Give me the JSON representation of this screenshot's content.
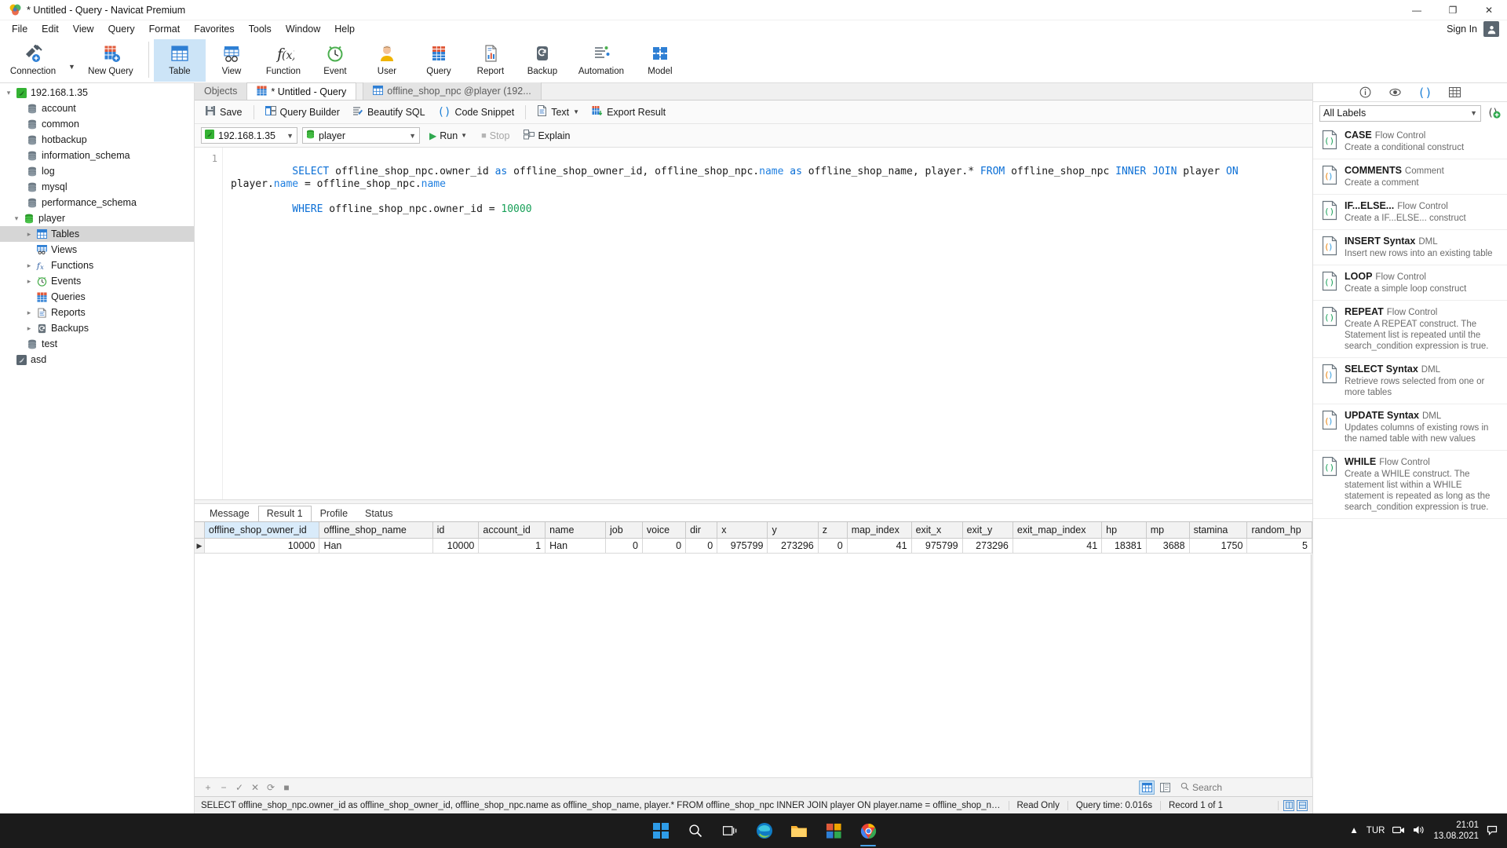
{
  "window": {
    "title": "* Untitled - Query - Navicat Premium",
    "minimize": "—",
    "maximize": "❐",
    "close": "✕"
  },
  "menu": {
    "items": [
      "File",
      "Edit",
      "View",
      "Query",
      "Format",
      "Favorites",
      "Tools",
      "Window",
      "Help"
    ],
    "sign_in": "Sign In"
  },
  "ribbon": {
    "items": [
      {
        "label": "Connection",
        "icon": "connection-icon"
      },
      {
        "label": "New Query",
        "icon": "new-query-icon"
      },
      {
        "label": "Table",
        "icon": "table-icon",
        "selected": true
      },
      {
        "label": "View",
        "icon": "view-icon"
      },
      {
        "label": "Function",
        "icon": "function-icon"
      },
      {
        "label": "Event",
        "icon": "event-icon"
      },
      {
        "label": "User",
        "icon": "user-icon"
      },
      {
        "label": "Query",
        "icon": "query-icon"
      },
      {
        "label": "Report",
        "icon": "report-icon"
      },
      {
        "label": "Backup",
        "icon": "backup-icon"
      },
      {
        "label": "Automation",
        "icon": "automation-icon"
      },
      {
        "label": "Model",
        "icon": "model-icon"
      }
    ]
  },
  "tree": [
    {
      "label": "192.168.1.35",
      "depth": 0,
      "arrow": "down",
      "icon": "connection-host-icon"
    },
    {
      "label": "account",
      "depth": 1,
      "arrow": "",
      "icon": "database-icon"
    },
    {
      "label": "common",
      "depth": 1,
      "arrow": "",
      "icon": "database-icon"
    },
    {
      "label": "hotbackup",
      "depth": 1,
      "arrow": "",
      "icon": "database-icon"
    },
    {
      "label": "information_schema",
      "depth": 1,
      "arrow": "",
      "icon": "database-icon"
    },
    {
      "label": "log",
      "depth": 1,
      "arrow": "",
      "icon": "database-icon"
    },
    {
      "label": "mysql",
      "depth": 1,
      "arrow": "",
      "icon": "database-icon"
    },
    {
      "label": "performance_schema",
      "depth": 1,
      "arrow": "",
      "icon": "database-icon"
    },
    {
      "label": "player",
      "depth": 1,
      "arrow": "down",
      "icon": "database-open-icon"
    },
    {
      "label": "Tables",
      "depth": 2,
      "arrow": "right",
      "icon": "tables-icon",
      "selected": true
    },
    {
      "label": "Views",
      "depth": 2,
      "arrow": "",
      "icon": "views-icon"
    },
    {
      "label": "Functions",
      "depth": 2,
      "arrow": "right",
      "icon": "functions-icon"
    },
    {
      "label": "Events",
      "depth": 2,
      "arrow": "right",
      "icon": "events-icon"
    },
    {
      "label": "Queries",
      "depth": 2,
      "arrow": "",
      "icon": "queries-icon"
    },
    {
      "label": "Reports",
      "depth": 2,
      "arrow": "right",
      "icon": "reports-icon"
    },
    {
      "label": "Backups",
      "depth": 2,
      "arrow": "right",
      "icon": "backups-icon"
    },
    {
      "label": "test",
      "depth": 1,
      "arrow": "",
      "icon": "database-icon"
    },
    {
      "label": "asd",
      "depth": 0,
      "arrow": "",
      "icon": "connection-host-icon"
    }
  ],
  "tabs": {
    "objects": "Objects",
    "query": "* Untitled - Query",
    "table": "offline_shop_npc @player (192..."
  },
  "query_toolbar": {
    "save": "Save",
    "query_builder": "Query Builder",
    "beautify_sql": "Beautify SQL",
    "code_snippet": "Code Snippet",
    "text": "Text",
    "export_result": "Export Result"
  },
  "connection_bar": {
    "host": "192.168.1.35",
    "database": "player",
    "run": "Run",
    "stop": "Stop",
    "explain": "Explain"
  },
  "editor": {
    "line_number": "1",
    "sql_line1_parts": [
      {
        "t": "SELECT ",
        "c": "kw"
      },
      {
        "t": "offline_shop_npc.owner_id ",
        "c": ""
      },
      {
        "t": "as ",
        "c": "kw"
      },
      {
        "t": "offline_shop_owner_id, offline_shop_npc.",
        "c": ""
      },
      {
        "t": "name ",
        "c": "fn"
      },
      {
        "t": "as ",
        "c": "kw"
      },
      {
        "t": "offline_shop_name, player.* ",
        "c": ""
      },
      {
        "t": "FROM ",
        "c": "kw"
      },
      {
        "t": "offline_shop_npc ",
        "c": ""
      },
      {
        "t": "INNER JOIN ",
        "c": "kw"
      },
      {
        "t": "player ",
        "c": ""
      },
      {
        "t": "ON ",
        "c": "kw"
      },
      {
        "t": "player.",
        "c": ""
      },
      {
        "t": "name ",
        "c": "fn"
      },
      {
        "t": "= offline_shop_npc.",
        "c": ""
      },
      {
        "t": "name",
        "c": "fn"
      }
    ],
    "sql_line2_parts": [
      {
        "t": "WHERE ",
        "c": "kw"
      },
      {
        "t": "offline_shop_npc.owner_id = ",
        "c": ""
      },
      {
        "t": "10000",
        "c": "num"
      }
    ]
  },
  "results": {
    "tabs": [
      "Message",
      "Result 1",
      "Profile",
      "Status"
    ],
    "active_tab": "Result 1",
    "columns": [
      "offline_shop_owner_id",
      "offline_shop_name",
      "id",
      "account_id",
      "name",
      "job",
      "voice",
      "dir",
      "x",
      "y",
      "z",
      "map_index",
      "exit_x",
      "exit_y",
      "exit_map_index",
      "hp",
      "mp",
      "stamina",
      "random_hp"
    ],
    "rows": [
      {
        "offline_shop_owner_id": "10000",
        "offline_shop_name": "Han",
        "id": "10000",
        "account_id": "1",
        "name": "Han",
        "job": "0",
        "voice": "0",
        "dir": "0",
        "x": "975799",
        "y": "273296",
        "z": "0",
        "map_index": "41",
        "exit_x": "975799",
        "exit_y": "273296",
        "exit_map_index": "41",
        "hp": "18381",
        "mp": "3688",
        "stamina": "1750",
        "random_hp": "5"
      }
    ]
  },
  "grid_footer": {
    "add": "+",
    "remove": "−",
    "confirm": "✓",
    "cancel": "✕",
    "refresh": "⟳",
    "stop": "■",
    "search_placeholder": "Search"
  },
  "status_bar": {
    "sql": "SELECT offline_shop_npc.owner_id as offline_shop_owner_id, offline_shop_npc.name as offline_shop_name, player.* FROM offline_shop_npc INNER JOIN player ON player.name = offline_shop_npc.name WHERE offline_shop_npc",
    "read_only": "Read Only",
    "query_time": "Query time: 0.016s",
    "record": "Record 1 of 1"
  },
  "snippets_panel": {
    "filter_value": "All Labels",
    "top_icons": [
      "info-icon",
      "eye-icon",
      "parentheses-icon",
      "grid-icon"
    ],
    "add_icon": "add-snippet-icon",
    "items": [
      {
        "title": "CASE",
        "category": "Flow Control",
        "desc": "Create a conditional construct",
        "color": "#18a058"
      },
      {
        "title": "COMMENTS",
        "category": "Comment",
        "desc": "Create a comment",
        "color": "#e8820c"
      },
      {
        "title": "IF...ELSE...",
        "category": "Flow Control",
        "desc": "Create a IF...ELSE... construct",
        "color": "#18a058"
      },
      {
        "title": "INSERT Syntax",
        "category": "DML",
        "desc": "Insert new rows into an existing table",
        "color": "#e8820c"
      },
      {
        "title": "LOOP",
        "category": "Flow Control",
        "desc": "Create a simple loop construct",
        "color": "#18a058"
      },
      {
        "title": "REPEAT",
        "category": "Flow Control",
        "desc": "Create A REPEAT construct. The Statement list is repeated until the search_condition expression is true.",
        "color": "#18a058"
      },
      {
        "title": "SELECT Syntax",
        "category": "DML",
        "desc": "Retrieve rows selected from one or more tables",
        "color": "#e8820c"
      },
      {
        "title": "UPDATE Syntax",
        "category": "DML",
        "desc": "Updates columns of existing rows in the named table with new values",
        "color": "#e8820c"
      },
      {
        "title": "WHILE",
        "category": "Flow Control",
        "desc": "Create a WHILE construct. The statement list within a WHILE statement is repeated as long as the search_condition expression is true.",
        "color": "#18a058"
      }
    ]
  },
  "taskbar": {
    "items": [
      "start-icon",
      "search-icon",
      "task-view-icon",
      "edge-icon",
      "file-explorer-icon",
      "navicat-icon",
      "chrome-icon"
    ],
    "language": "TUR",
    "time": "21:01",
    "date": "13.08.2021"
  }
}
